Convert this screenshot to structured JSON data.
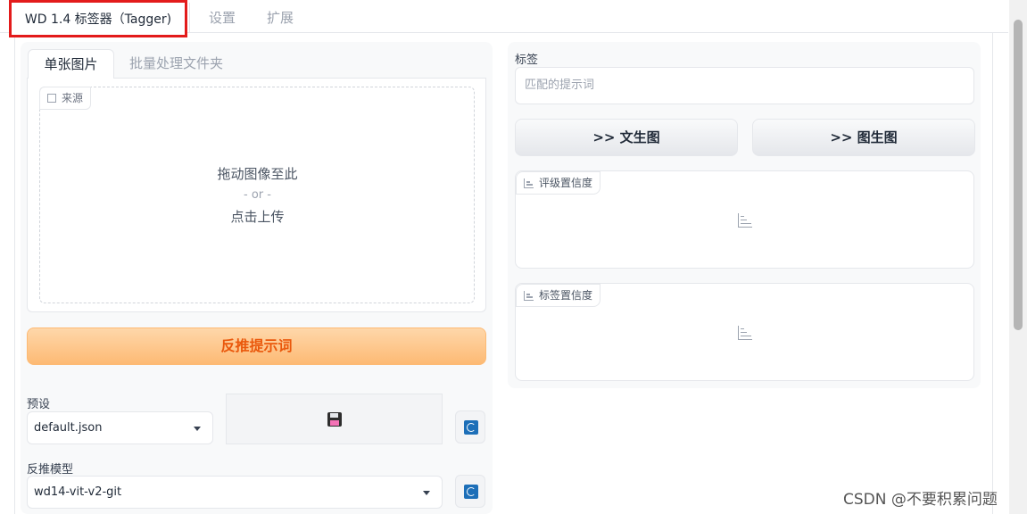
{
  "top_tabs": [
    "WD 1.4 标签器（Tagger)",
    "设置",
    "扩展"
  ],
  "sub_tabs": [
    "单张图片",
    "批量处理文件夹"
  ],
  "upload": {
    "label": "来源",
    "drop_text": "拖动图像至此",
    "or_text": "- or -",
    "click_text": "点击上传"
  },
  "interrogate_label": "反推提示词",
  "preset": {
    "label": "预设",
    "value": "default.json"
  },
  "model": {
    "label": "反推模型",
    "value": "wd14-vit-v2-git"
  },
  "tags": {
    "label": "标签",
    "placeholder": "匹配的提示词"
  },
  "send_txt2img": ">> 文生图",
  "send_img2img": ">> 图生图",
  "rating_label": "评级置信度",
  "tag_conf_label": "标签置信度",
  "watermark": "CSDN @不要积累问题",
  "colors": {
    "highlight_border": "#e31b1b",
    "primary_text": "#ea580c"
  }
}
